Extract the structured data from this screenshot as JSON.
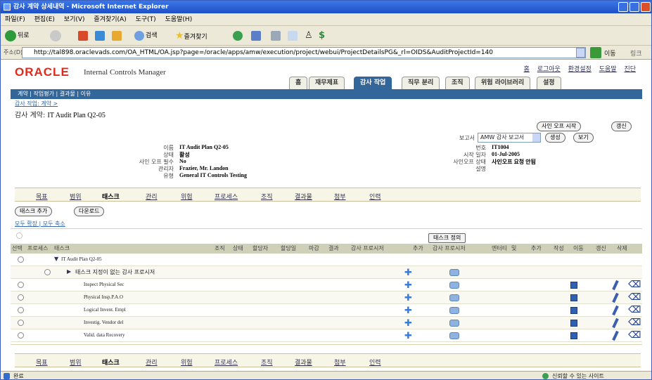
{
  "window": {
    "title": "감사 계약 상세내역 - Microsoft Internet Explorer"
  },
  "menu": [
    "파일(F)",
    "편집(E)",
    "보기(V)",
    "즐겨찾기(A)",
    "도구(T)",
    "도움말(H)"
  ],
  "toolbar": {
    "back": "뒤로",
    "search": "검색",
    "favorites": "즐겨찾기"
  },
  "address": {
    "label": "주소(D)",
    "url": "http://tal898.oraclevads.com/OA_HTML/OA.jsp?page=/oracle/apps/amw/execution/project/webui/ProjectDetailsPG&_rl=OIDS&AuditProjectId=140",
    "go": "이동",
    "links": "링크"
  },
  "app": {
    "logo": "ORACLE",
    "product": "Internal Controls Manager",
    "global_links": [
      "홈",
      "로그아웃",
      "환경설정",
      "도움말",
      "진단"
    ]
  },
  "tabs": [
    "홈",
    "재무제표",
    "감사 작업",
    "직무 분리",
    "조직",
    "위험 라이브러리",
    "설정"
  ],
  "navbar": "계약 | 작업평가 | 결과물 | 이유",
  "breadcrumb": "감사 작업: 계약 >",
  "page": {
    "title_prefix": "감사 계약:",
    "title_value": "IT Audit Plan Q2-05"
  },
  "buttons": {
    "start_signoff": "사인 오프 시작",
    "update": "갱신",
    "create": "생성",
    "view": "보기",
    "add_task": "태스크 추가",
    "download": "다운로드",
    "task_info": "태스크 정의"
  },
  "report": {
    "label": "보고서",
    "selected": "AMW 감사 보고서"
  },
  "details_left": [
    {
      "label": "이름",
      "value": "IT Audit Plan Q2-05"
    },
    {
      "label": "상태",
      "value": "활성"
    },
    {
      "label": "사인 오프 필수",
      "value": "No"
    },
    {
      "label": "관리자",
      "value": "Frazier, Mr. Landon"
    },
    {
      "label": "유형",
      "value": "General IT Controls Testing"
    }
  ],
  "details_right": [
    {
      "label": "번호",
      "value": "IT1004"
    },
    {
      "label": "시작 일자",
      "value": "01-Jul-2005"
    },
    {
      "label": "사인오프 상태",
      "value": "사인오프 요청 안됨"
    },
    {
      "label": "설명",
      "value": ""
    }
  ],
  "subtabs": [
    "목표",
    "범위",
    "태스크",
    "관리",
    "위험",
    "프로세스",
    "조직",
    "결과물",
    "첨부",
    "인력"
  ],
  "expand_links": "모두 확장 | 모두 축소",
  "table": {
    "headers": [
      "선택",
      "프로세스",
      "태스크",
      "조직",
      "상태",
      "할당자",
      "할당일",
      "마감",
      "결과",
      "감사 프로시저",
      "추가",
      "감사 프로시저",
      "엔터티",
      "및",
      "추가",
      "작성",
      "이동",
      "갱신",
      "삭제"
    ],
    "rows": [
      {
        "task": "IT Audit Plan Q2-05",
        "level": 0
      },
      {
        "task": "태스크 지정이 없는 감사 프로시저",
        "level": 1
      },
      {
        "task": "Inspect Physical Sec",
        "level": 2
      },
      {
        "task": "Physical Insp.P.A.O",
        "level": 2
      },
      {
        "task": "Logical Invent. Empl",
        "level": 2
      },
      {
        "task": "Investig. Vendor del",
        "level": 2
      },
      {
        "task": "Valid. data Recovery",
        "level": 2
      }
    ]
  },
  "status": {
    "left": "완료",
    "right": "신뢰할 수 있는 사이트"
  }
}
